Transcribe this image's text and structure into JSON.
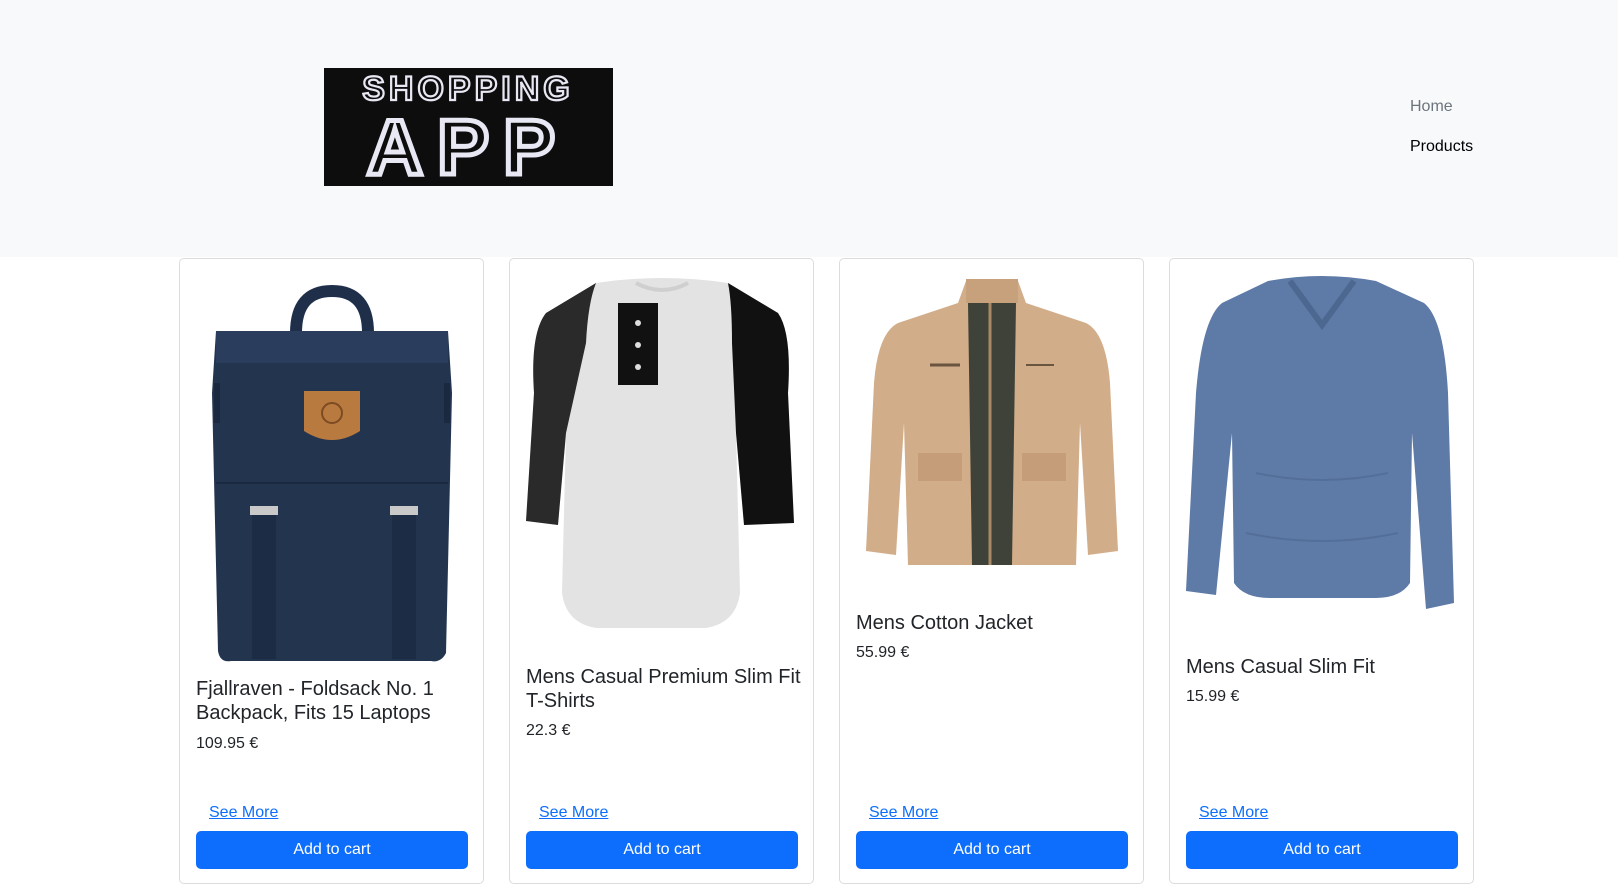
{
  "header": {
    "logo": {
      "line1": "SHOPPING",
      "line2": "APP"
    },
    "nav": {
      "home": "Home",
      "products": "Products"
    }
  },
  "colors": {
    "accent": "#0d6efd",
    "header_bg": "#f8f9fa",
    "logo_bg": "#0d0d0d"
  },
  "products": [
    {
      "title": "Fjallraven - Foldsack No. 1 Backpack, Fits 15 Laptops",
      "price": "109.95 €",
      "see_more": "See More",
      "add_to_cart": "Add to cart",
      "image": "navy-backpack"
    },
    {
      "title": "Mens Casual Premium Slim Fit T-Shirts",
      "price": "22.3 €",
      "see_more": "See More",
      "add_to_cart": "Add to cart",
      "image": "raglan-henley-tshirt"
    },
    {
      "title": "Mens Cotton Jacket",
      "price": "55.99 €",
      "see_more": "See More",
      "add_to_cart": "Add to cart",
      "image": "beige-cotton-jacket"
    },
    {
      "title": "Mens Casual Slim Fit",
      "price": "15.99 €",
      "see_more": "See More",
      "add_to_cart": "Add to cart",
      "image": "blue-long-sleeve-shirt"
    }
  ]
}
